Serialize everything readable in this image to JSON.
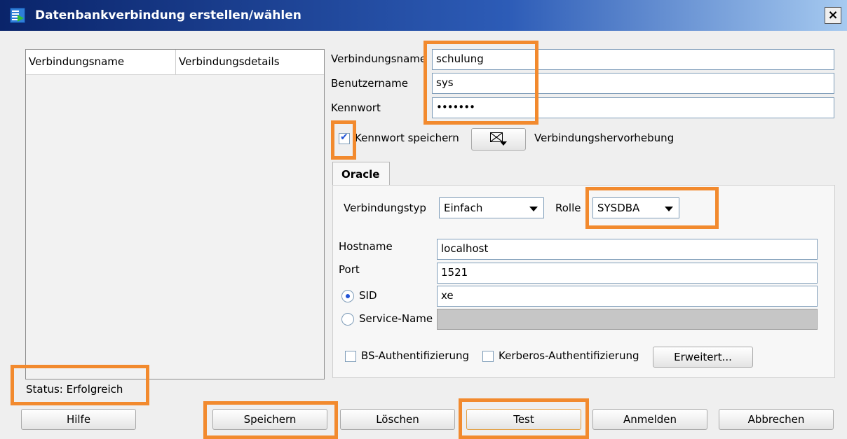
{
  "window": {
    "title": "Datenbankverbindung erstellen/wählen",
    "close_label": "×"
  },
  "connections_list": {
    "columns": [
      "Verbindungsname",
      "Verbindungsdetails"
    ]
  },
  "form": {
    "connection_name": {
      "label": "Verbindungsname",
      "value": "schulung"
    },
    "username": {
      "label": "Benutzername",
      "value": "sys"
    },
    "password": {
      "label": "Kennwort",
      "value": "•••••••"
    },
    "save_password": {
      "label": "Kennwort speichern",
      "checked": true
    },
    "highlight_label": "Verbindungshervorhebung"
  },
  "tabs": [
    {
      "label": "Oracle",
      "active": true
    }
  ],
  "oracle": {
    "connection_type": {
      "label": "Verbindungstyp",
      "value": "Einfach"
    },
    "role": {
      "label": "Rolle",
      "value": "SYSDBA"
    },
    "hostname": {
      "label": "Hostname",
      "value": "localhost"
    },
    "port": {
      "label": "Port",
      "value": "1521"
    },
    "sid": {
      "label": "SID",
      "value": "xe",
      "selected": true
    },
    "service_name": {
      "label": "Service-Name",
      "value": "",
      "selected": false
    },
    "os_auth": {
      "label": "BS-Authentifizierung",
      "checked": false
    },
    "kerberos_auth": {
      "label": "Kerberos-Authentifizierung",
      "checked": false
    },
    "advanced_button": "Erweitert..."
  },
  "status": "Status: Erfolgreich",
  "buttons": {
    "help": "Hilfe",
    "save": "Speichern",
    "delete": "Löschen",
    "test": "Test",
    "connect": "Anmelden",
    "cancel": "Abbrechen"
  },
  "colors": {
    "highlight": "#f28a2e",
    "title_bar": "#0a246a"
  }
}
